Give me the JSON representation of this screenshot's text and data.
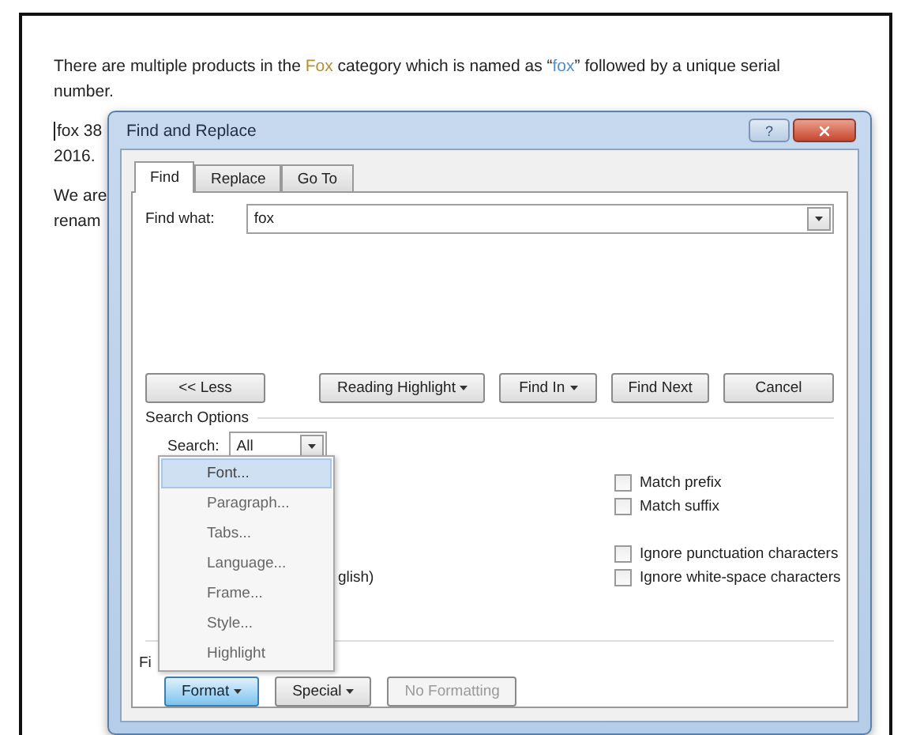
{
  "document": {
    "paragraphs": [
      {
        "segments": [
          {
            "text": "There are multiple products in the ",
            "color": "#222222"
          },
          {
            "text": "Fox",
            "color": "#b8902c"
          },
          {
            "text": " category which is named as “",
            "color": "#222222"
          },
          {
            "text": "fox",
            "color": "#4a8fd0"
          },
          {
            "text": "” followed by a unique serial number.",
            "color": "#222222"
          }
        ]
      },
      {
        "lines": [
          "fox 38",
          "2016."
        ],
        "cursor": true
      },
      {
        "lines": [
          "We are",
          "renam"
        ]
      }
    ]
  },
  "dialog": {
    "title": "Find and Replace",
    "help_button": "?",
    "tabs": [
      {
        "label": "Find",
        "selected": true
      },
      {
        "label": "Replace",
        "selected": false
      },
      {
        "label": "Go To",
        "selected": false
      }
    ],
    "find_what": {
      "label": "Find what:",
      "value": "fox"
    },
    "buttons": [
      {
        "label": "<< Less",
        "dropdown": false
      },
      {
        "label": "Reading Highlight",
        "dropdown": true
      },
      {
        "label": "Find In",
        "dropdown": true
      },
      {
        "label": "Find Next",
        "dropdown": false
      },
      {
        "label": "Cancel",
        "dropdown": false
      }
    ],
    "search_options": {
      "label": "Search Options",
      "search_label": "Search:",
      "search_value": "All"
    },
    "options": [
      {
        "label": "Match prefix",
        "checked": false
      },
      {
        "label": "Match suffix",
        "checked": false
      },
      {
        "label": "Ignore punctuation characters",
        "checked": false
      },
      {
        "label": "Ignore white-space characters",
        "checked": false
      }
    ],
    "partial_text": "glish)",
    "find_section_label": "Fi",
    "bottom_buttons": [
      {
        "label": "Format",
        "dropdown": true,
        "pressed": true,
        "disabled": false
      },
      {
        "label": "Special",
        "dropdown": true,
        "pressed": false,
        "disabled": false
      },
      {
        "label": "No Formatting",
        "dropdown": false,
        "pressed": false,
        "disabled": true
      }
    ],
    "format_menu": [
      {
        "label": "Font...",
        "selected": true
      },
      {
        "label": "Paragraph...",
        "selected": false
      },
      {
        "label": "Tabs...",
        "selected": false
      },
      {
        "label": "Language...",
        "selected": false
      },
      {
        "label": "Frame...",
        "selected": false
      },
      {
        "label": "Style...",
        "selected": false
      },
      {
        "label": "Highlight",
        "selected": false
      }
    ]
  }
}
